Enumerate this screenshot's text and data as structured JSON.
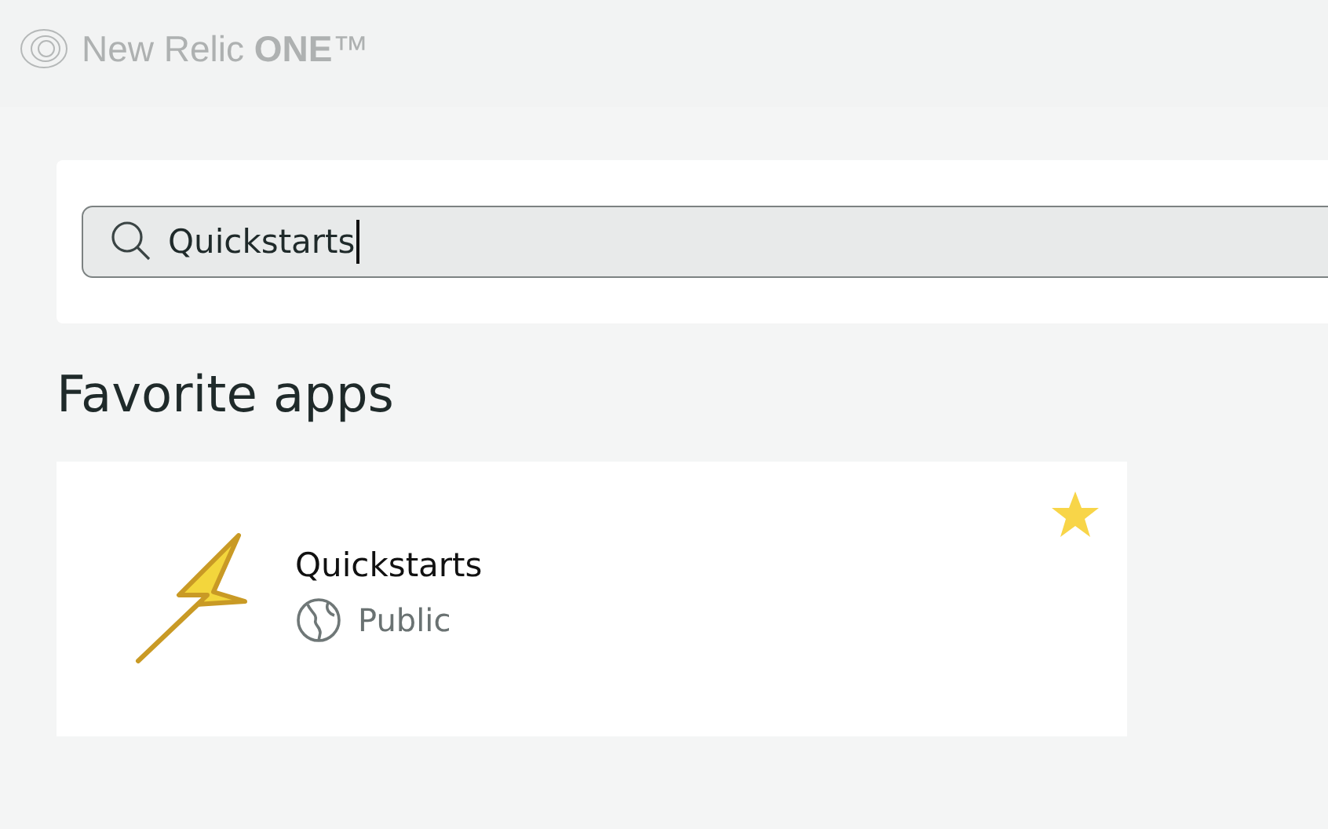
{
  "header": {
    "logo": "New Relic **ONE**™"
  },
  "search": {
    "value": "Quickstarts",
    "focused": true
  },
  "section": {
    "title": "Favorite apps"
  },
  "apps": [
    {
      "name": "Quickstarts",
      "visibility": "Public",
      "favorite": true
    }
  ]
}
